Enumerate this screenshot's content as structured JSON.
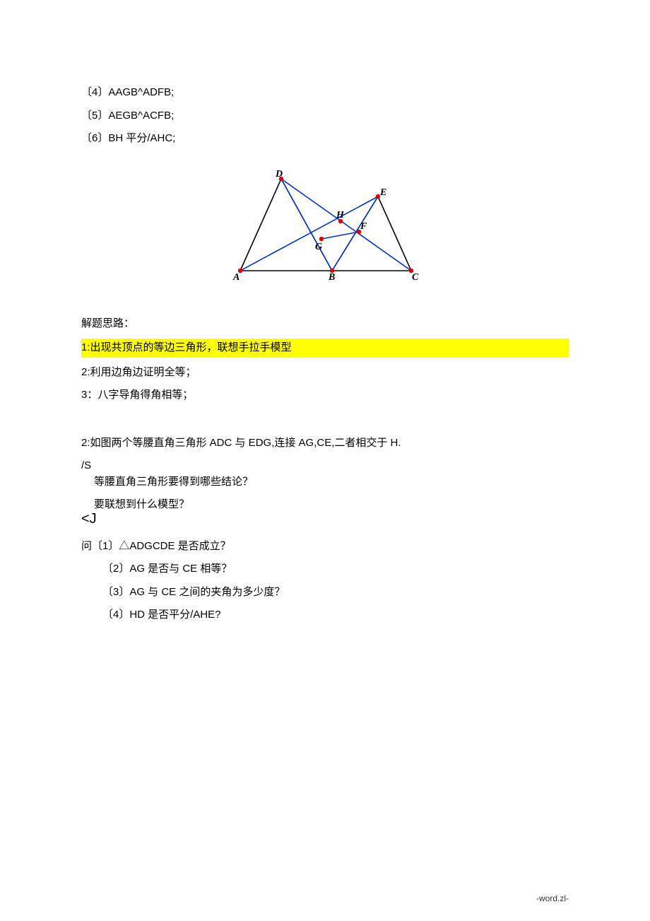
{
  "lines": {
    "l4": "〔4〕AAGB^ADFB;",
    "l5": "〔5〕AEGB^ACFB;",
    "l6": "〔6〕BH 平分/AHC;"
  },
  "figure": {
    "labels": {
      "A": "A",
      "B": "B",
      "C": "C",
      "D": "D",
      "E": "E",
      "G": "G",
      "H": "H",
      "F": "F"
    }
  },
  "solution_heading": "解题思路：",
  "step1": "1:出现共顶点的等边三角形，联想手拉手模型",
  "step2": "2:利用边角边证明全等；",
  "step3": "3：八字导角得角相等；",
  "problem2_intro": "2:如图两个等腰直角三角形 ADC 与 EDG,连接 AG,CE,二者相交于 H.",
  "slashS": "/S",
  "note1": "等腰直角三角形要得到哪些结论？",
  "note2": "要联想到什么模型？",
  "bracketJ": "<J",
  "q_intro": "问〔1〕△ADGCDE 是否成立？",
  "q2": "〔2〕AG 是否与 CE 相等？",
  "q3": "〔3〕AG 与 CE 之间的夹角为多少度？",
  "q4": "〔4〕HD 是否平分/AHE?",
  "footer": "-word.zl-"
}
